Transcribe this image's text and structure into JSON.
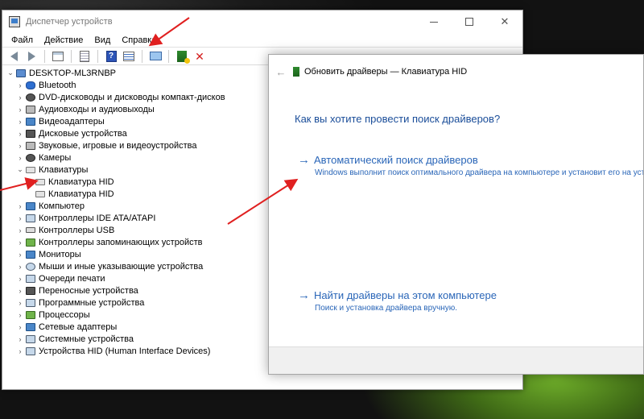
{
  "window": {
    "title": "Диспетчер устройств",
    "controls": {
      "minimize": "",
      "maximize": "",
      "close": "✕"
    }
  },
  "menu": [
    "Файл",
    "Действие",
    "Вид",
    "Справка"
  ],
  "toolbar": {
    "icons": [
      "back-icon",
      "forward-icon",
      "properties-icon",
      "document-icon",
      "help-icon",
      "list-icon",
      "monitor-icon",
      "update-driver-icon",
      "remove-device-icon"
    ],
    "help_glyph": "?",
    "remove_glyph": "✕"
  },
  "tree": {
    "root": "DESKTOP-ML3RNBP",
    "items": [
      {
        "label": "Bluetooth",
        "expanded": false,
        "icon": "bluetooth-icon"
      },
      {
        "label": "DVD-дисководы и дисководы компакт-дисков",
        "expanded": false,
        "icon": "dvd-icon"
      },
      {
        "label": "Аудиовходы и аудиовыходы",
        "expanded": false,
        "icon": "audio-icon"
      },
      {
        "label": "Видеоадаптеры",
        "expanded": false,
        "icon": "display-adapter-icon"
      },
      {
        "label": "Дисковые устройства",
        "expanded": false,
        "icon": "disk-icon"
      },
      {
        "label": "Звуковые, игровые и видеоустройства",
        "expanded": false,
        "icon": "sound-icon"
      },
      {
        "label": "Камеры",
        "expanded": false,
        "icon": "camera-icon"
      },
      {
        "label": "Клавиатуры",
        "expanded": true,
        "icon": "keyboard-icon",
        "children": [
          "Клавиатура HID",
          "Клавиатура HID"
        ]
      },
      {
        "label": "Компьютер",
        "expanded": false,
        "icon": "computer-icon"
      },
      {
        "label": "Контроллеры IDE ATA/ATAPI",
        "expanded": false,
        "icon": "ide-controller-icon"
      },
      {
        "label": "Контроллеры USB",
        "expanded": false,
        "icon": "usb-icon"
      },
      {
        "label": "Контроллеры запоминающих устройств",
        "expanded": false,
        "icon": "storage-controller-icon"
      },
      {
        "label": "Мониторы",
        "expanded": false,
        "icon": "monitor-icon"
      },
      {
        "label": "Мыши и иные указывающие устройства",
        "expanded": false,
        "icon": "mouse-icon"
      },
      {
        "label": "Очереди печати",
        "expanded": false,
        "icon": "print-queue-icon"
      },
      {
        "label": "Переносные устройства",
        "expanded": false,
        "icon": "portable-device-icon"
      },
      {
        "label": "Программные устройства",
        "expanded": false,
        "icon": "software-device-icon"
      },
      {
        "label": "Процессоры",
        "expanded": false,
        "icon": "processor-icon"
      },
      {
        "label": "Сетевые адаптеры",
        "expanded": false,
        "icon": "network-adapter-icon"
      },
      {
        "label": "Системные устройства",
        "expanded": false,
        "icon": "system-device-icon"
      },
      {
        "label": "Устройства HID (Human Interface Devices)",
        "expanded": false,
        "icon": "hid-icon"
      }
    ]
  },
  "dialog": {
    "back": "←",
    "title": "Обновить драйверы — Клавиатура HID",
    "question": "Как вы хотите провести поиск драйверов?",
    "options": [
      {
        "arrow": "→",
        "title": "Автоматический поиск драйверов",
        "desc": "Windows выполнит поиск оптимального драйвера на компьютере и установит его на устройство"
      },
      {
        "arrow": "→",
        "title": "Найти драйверы на этом компьютере",
        "desc": "Поиск и установка драйвера вручную."
      }
    ]
  },
  "colors": {
    "annotation_arrow": "#e02020",
    "link_blue": "#2a66b8",
    "heading_blue": "#1a4d99"
  }
}
